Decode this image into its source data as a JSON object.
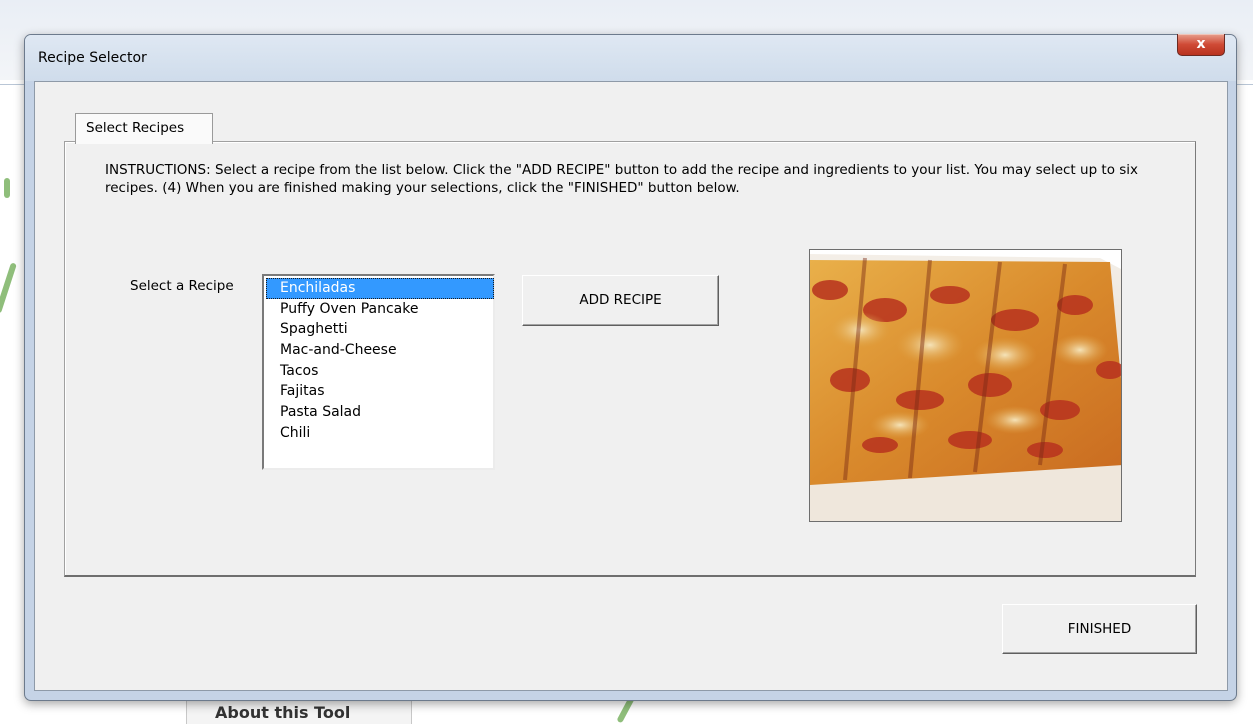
{
  "window": {
    "title": "Recipe Selector",
    "close_label": "x"
  },
  "background": {
    "about_label": "About this Tool"
  },
  "tabs": [
    {
      "label": "Select Recipes",
      "selected": true
    }
  ],
  "instructions": "INSTRUCTIONS: Select a recipe from the list below. Click the \"ADD RECIPE\" button to add the recipe and ingredients to your list. You may select up to six recipes. (4) When you are finished making your selections, click the \"FINISHED\" button below.",
  "recipe_select": {
    "label": "Select a Recipe",
    "selected": "Enchiladas",
    "items": [
      "Enchiladas",
      "Puffy Oven Pancake",
      "Spaghetti",
      "Mac-and-Cheese",
      "Tacos",
      "Fajitas",
      "Pasta Salad",
      "Chili"
    ]
  },
  "buttons": {
    "add_recipe": "ADD RECIPE",
    "finished": "FINISHED"
  },
  "photo": {
    "icon": "enchiladas-photo"
  },
  "colors": {
    "selection": "#3399ff",
    "dialog_bg": "#f0f0f0",
    "close_button": "#cf4a35"
  }
}
